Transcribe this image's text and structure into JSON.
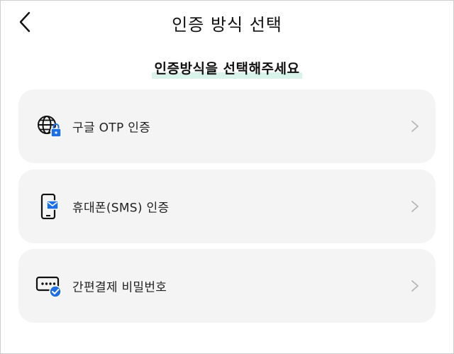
{
  "header": {
    "title": "인증 방식 선택",
    "back_icon": "chevron-left-icon"
  },
  "subtitle": "인증방식을 선택해주세요",
  "colors": {
    "card_bg": "#f4f4f4",
    "highlight": "#d9f3ea",
    "accent_blue": "#1d6fe8"
  },
  "options": [
    {
      "label": "구글 OTP 인증",
      "icon": "globe-lock-icon"
    },
    {
      "label": "휴대폰(SMS) 인증",
      "icon": "phone-message-icon"
    },
    {
      "label": "간편결제 비밀번호",
      "icon": "password-check-icon"
    }
  ]
}
